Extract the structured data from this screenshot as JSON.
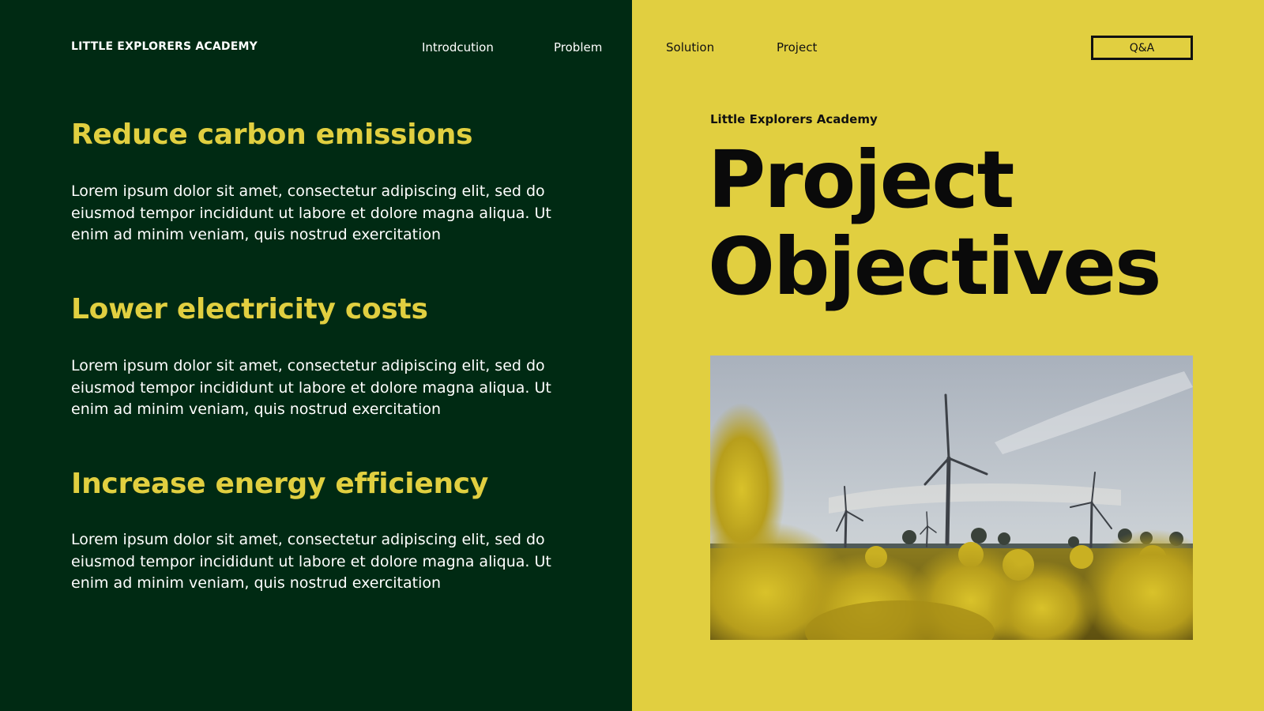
{
  "brand": "LITTLE EXPLORERS ACADEMY",
  "nav": {
    "items": [
      {
        "label": "Introdcution"
      },
      {
        "label": "Problem"
      },
      {
        "label": "Solution"
      },
      {
        "label": "Project"
      }
    ],
    "qa_label": "Q&A"
  },
  "objectives": [
    {
      "title": "Reduce carbon emissions",
      "text": "Lorem ipsum dolor sit amet, consectetur adipiscing elit, sed do eiusmod tempor incididunt ut labore et dolore magna aliqua. Ut enim ad minim veniam, quis nostrud exercitation"
    },
    {
      "title": "Lower electricity costs",
      "text": "Lorem ipsum dolor sit amet, consectetur adipiscing elit, sed do eiusmod tempor incididunt ut labore et dolore magna aliqua. Ut enim ad minim veniam, quis nostrud exercitation"
    },
    {
      "title": "Increase energy efficiency",
      "text": "Lorem ipsum dolor sit amet, consectetur adipiscing elit, sed do eiusmod tempor incididunt ut labore et dolore magna aliqua. Ut enim ad minim veniam, quis nostrud exercitation"
    }
  ],
  "hero": {
    "eyebrow": "Little Explorers Academy",
    "title_line1": "Project",
    "title_line2": "Objectives"
  },
  "colors": {
    "dark_green": "#002A13",
    "accent_yellow": "#E1CF40",
    "text_dark": "#0A0A0A",
    "text_light": "#FFFFFF"
  }
}
